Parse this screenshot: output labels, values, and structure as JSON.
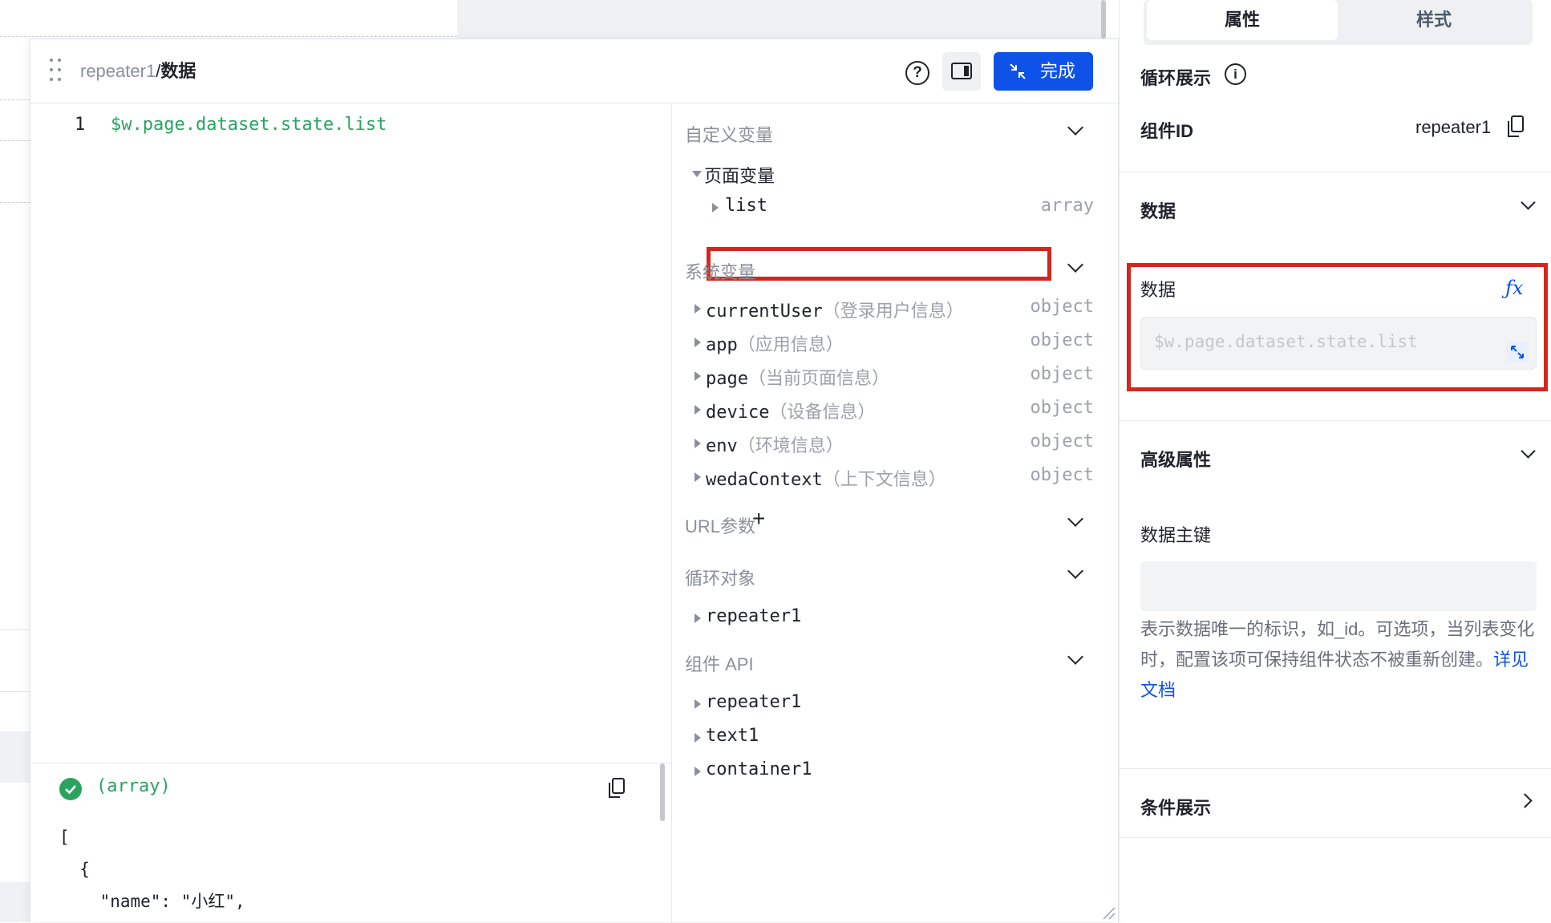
{
  "modal": {
    "breadcrumb_component": "repeater1",
    "breadcrumb_separator": "/",
    "breadcrumb_field": "数据",
    "help_icon": "?",
    "done_label": "完成"
  },
  "editor": {
    "line_number": "1",
    "code": "$w.page.dataset.state.list"
  },
  "result": {
    "type_label": "(array)",
    "json_preview": "[\n  {\n    \"name\": \"小红\","
  },
  "variables": {
    "custom_title": "自定义变量",
    "page_vars_label": "页面变量",
    "list_name": "list",
    "list_type": "array",
    "system_title": "系统变量",
    "system_items": [
      {
        "name": "currentUser",
        "desc": "（登录用户信息）",
        "type": "object"
      },
      {
        "name": "app",
        "desc": "（应用信息）",
        "type": "object"
      },
      {
        "name": "page",
        "desc": "（当前页面信息）",
        "type": "object"
      },
      {
        "name": "device",
        "desc": "（设备信息）",
        "type": "object"
      },
      {
        "name": "env",
        "desc": "（环境信息）",
        "type": "object"
      },
      {
        "name": "wedaContext",
        "desc": "（上下文信息）",
        "type": "object"
      }
    ],
    "url_title": "URL参数",
    "url_plus": "+",
    "loop_title": "循环对象",
    "loop_items": [
      "repeater1"
    ],
    "api_title": "组件 API",
    "api_items": [
      "repeater1",
      "text1",
      "container1"
    ]
  },
  "right_panel": {
    "tab_attr": "属性",
    "tab_style": "样式",
    "loop_display": "循环展示",
    "info_glyph": "i",
    "component_id_label": "组件ID",
    "component_id_value": "repeater1",
    "data_section": "数据",
    "data_field_label": "数据",
    "fx_label": "ƒx",
    "data_input_placeholder": "$w.page.dataset.state.list",
    "advanced_section": "高级属性",
    "key_label": "数据主键",
    "key_help": "表示数据唯一的标识，如_id。可选项，当列表变化时，配置该项可保持组件状态不被重新创建。",
    "key_help_link": "详见文档",
    "condition_section": "条件展示"
  },
  "colors": {
    "accent": "#0e52e8",
    "success": "#2aa35f",
    "highlight": "#d4261c"
  }
}
